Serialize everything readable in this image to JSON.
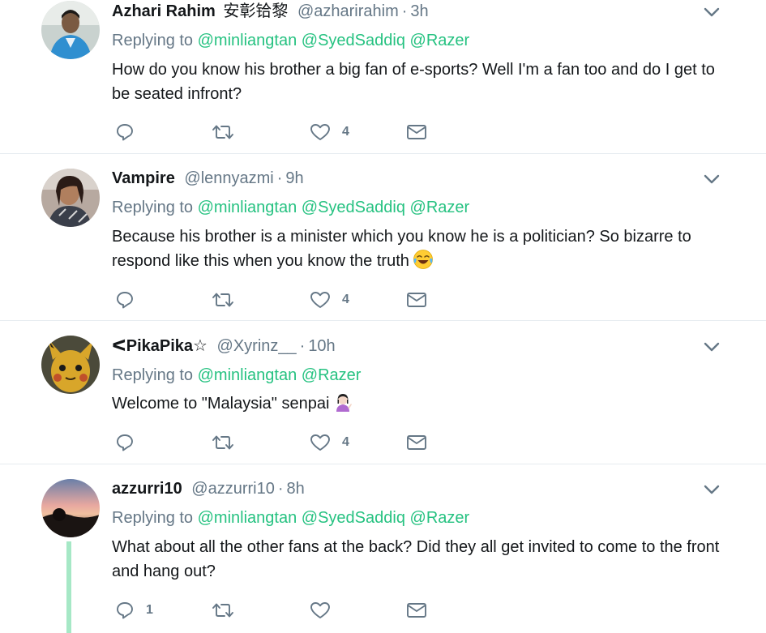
{
  "colors": {
    "accent": "#26c281",
    "muted": "#657786",
    "text": "#14171a",
    "thread_line": "#a6e8c6"
  },
  "tweets": [
    {
      "name": "Azhari Rahim",
      "name_suffix": "安彰铪黎",
      "handle": "@azharirahim",
      "dot": "·",
      "time": "3h",
      "reply_prefix": "Replying to",
      "mentions": [
        "@minliangtan",
        "@SyedSaddiq",
        "@Razer"
      ],
      "text": "How do you know his brother a big fan of e-sports? Well I'm a fan too and do I get to be seated infront?",
      "reply_count": "",
      "retweet_count": "",
      "like_count": "4"
    },
    {
      "name": "Vampire",
      "handle": "@lennyazmi",
      "dot": "·",
      "time": "9h",
      "reply_prefix": "Replying to",
      "mentions": [
        "@minliangtan",
        "@SyedSaddiq",
        "@Razer"
      ],
      "text": "Because his brother is a minister which you know he is a politician? So bizarre to respond like this when you know the truth",
      "emoji": "face-with-tears-of-joy",
      "reply_count": "",
      "retweet_count": "",
      "like_count": "4"
    },
    {
      "name": "ᐸPikaPika☆",
      "handle": "@Xyrinz__",
      "dot": "·",
      "time": "10h",
      "reply_prefix": "Replying to",
      "mentions": [
        "@minliangtan",
        "@Razer"
      ],
      "text": "Welcome to \"Malaysia\" senpai",
      "emoji": "person-tipping-hand",
      "reply_count": "",
      "retweet_count": "",
      "like_count": "4"
    },
    {
      "name": "azzurri10",
      "handle": "@azzurri10",
      "dot": "·",
      "time": "8h",
      "reply_prefix": "Replying to",
      "mentions": [
        "@minliangtan",
        "@SyedSaddiq",
        "@Razer"
      ],
      "text": "What about all the other fans at the back? Did they all get invited to come to the front and hang out?",
      "reply_count": "1",
      "retweet_count": "",
      "like_count": ""
    }
  ]
}
